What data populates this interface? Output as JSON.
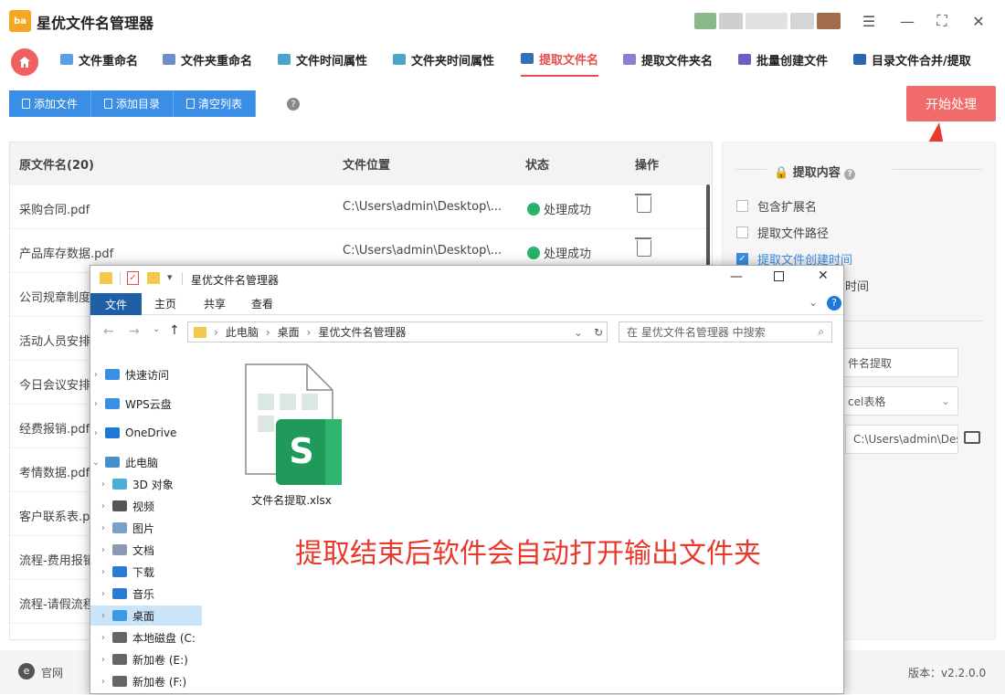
{
  "app": {
    "title": "星优文件名管理器",
    "logo_text": "ba"
  },
  "tabs": [
    {
      "label": "文件重命名",
      "color": "#5aa0e6"
    },
    {
      "label": "文件夹重命名",
      "color": "#6b8fc9"
    },
    {
      "label": "文件时间属性",
      "color": "#4aa6c8"
    },
    {
      "label": "文件夹时间属性",
      "color": "#4aa6c8"
    },
    {
      "label": "提取文件名",
      "color": "#3a6fb8"
    },
    {
      "label": "提取文件夹名",
      "color": "#8a7fd0"
    },
    {
      "label": "批量创建文件",
      "color": "#6c5fc7"
    },
    {
      "label": "目录文件合并/提取",
      "color": "#2f66b3"
    }
  ],
  "toolbar": {
    "add_file": "添加文件",
    "add_dir": "添加目录",
    "clear": "清空列表",
    "start": "开始处理"
  },
  "table": {
    "headers": {
      "name": "原文件名(20)",
      "location": "文件位置",
      "status": "状态",
      "action": "操作"
    },
    "rows": [
      {
        "name": "采购合同.pdf",
        "location": "C:\\Users\\admin\\Desktop\\...",
        "status": "处理成功"
      },
      {
        "name": "产品库存数据.pdf",
        "location": "C:\\Users\\admin\\Desktop\\...",
        "status": "处理成功"
      },
      {
        "name": "公司规章制度"
      },
      {
        "name": "活动人员安排"
      },
      {
        "name": "今日会议安排"
      },
      {
        "name": "经费报销.pdf"
      },
      {
        "name": "考情数据.pdf"
      },
      {
        "name": "客户联系表.p"
      },
      {
        "name": "流程-费用报销"
      },
      {
        "name": "流程-请假流程"
      }
    ]
  },
  "panel": {
    "title": "提取内容",
    "options": [
      {
        "label": "包含扩展名",
        "checked": false
      },
      {
        "label": "提取文件路径",
        "checked": false
      },
      {
        "label": "提取文件创建时间",
        "checked": true
      },
      {
        "label": "时间",
        "checked": false
      }
    ],
    "field1": "件名提取",
    "field2": "cel表格",
    "field3": "C:\\Users\\admin\\Des"
  },
  "status": {
    "website": "官网",
    "version": "版本：v2.2.0.0"
  },
  "explorer": {
    "title": "星优文件名管理器",
    "ribbon": [
      "文件",
      "主页",
      "共享",
      "查看"
    ],
    "path": [
      "此电脑",
      "桌面",
      "星优文件名管理器"
    ],
    "search_placeholder": "在 星优文件名管理器 中搜索",
    "nav": [
      {
        "label": "快速访问",
        "color": "#3a8ee6"
      },
      {
        "label": "WPS云盘",
        "color": "#3a8ee6"
      },
      {
        "label": "OneDrive",
        "color": "#1e78d6"
      },
      {
        "label": "此电脑",
        "color": "#4a90c8"
      },
      {
        "label": "3D 对象",
        "color": "#4ab0d8"
      },
      {
        "label": "视频",
        "color": "#555555"
      },
      {
        "label": "图片",
        "color": "#7aa0c8"
      },
      {
        "label": "文档",
        "color": "#8a9ab0"
      },
      {
        "label": "下载",
        "color": "#2a7ad6"
      },
      {
        "label": "音乐",
        "color": "#2a7ad6"
      },
      {
        "label": "桌面",
        "color": "#3a9ae6"
      },
      {
        "label": "本地磁盘 (C:",
        "color": "#666666"
      },
      {
        "label": "新加卷 (E:)",
        "color": "#666666"
      },
      {
        "label": "新加卷 (F:)",
        "color": "#666666"
      }
    ],
    "file_name": "文件名提取.xlsx",
    "file_icon_letter": "S"
  },
  "note": "提取结束后软件会自动打开输出文件夹"
}
